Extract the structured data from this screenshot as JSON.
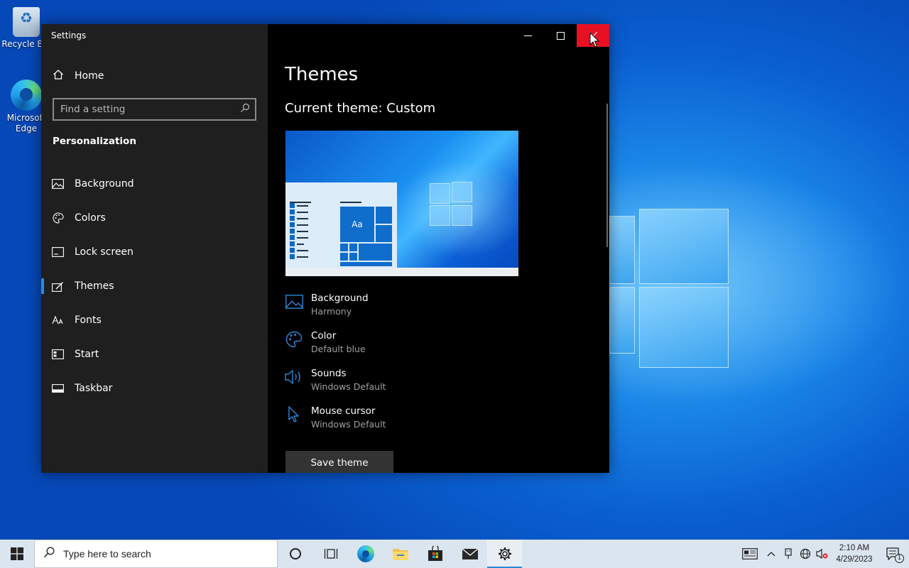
{
  "desktop": {
    "icons": [
      {
        "label": "Recycle Bin"
      },
      {
        "label": "Microsoft Edge"
      }
    ]
  },
  "window": {
    "title": "Settings",
    "nav": {
      "home_label": "Home",
      "search_placeholder": "Find a setting",
      "section_title": "Personalization",
      "items": [
        {
          "label": "Background",
          "icon": "picture-icon"
        },
        {
          "label": "Colors",
          "icon": "palette-icon"
        },
        {
          "label": "Lock screen",
          "icon": "lock-screen-icon"
        },
        {
          "label": "Themes",
          "icon": "themes-icon",
          "selected": true
        },
        {
          "label": "Fonts",
          "icon": "font-icon"
        },
        {
          "label": "Start",
          "icon": "start-icon"
        },
        {
          "label": "Taskbar",
          "icon": "taskbar-icon"
        }
      ]
    },
    "main": {
      "title": "Themes",
      "current_theme": "Current theme: Custom",
      "preview_tile_text": "Aa",
      "properties": [
        {
          "name": "Background",
          "value": "Harmony",
          "icon": "picture-icon"
        },
        {
          "name": "Color",
          "value": "Default blue",
          "icon": "palette-icon"
        },
        {
          "name": "Sounds",
          "value": "Windows Default",
          "icon": "speaker-icon"
        },
        {
          "name": "Mouse cursor",
          "value": "Windows Default",
          "icon": "cursor-icon"
        }
      ],
      "save_button": "Save theme"
    }
  },
  "taskbar": {
    "search_placeholder": "Type here to search",
    "apps": [
      "cortana-icon",
      "task-view-icon",
      "edge-icon",
      "file-explorer-icon",
      "store-icon",
      "mail-icon",
      "settings-icon"
    ],
    "clock": {
      "time": "2:10 AM",
      "date": "4/29/2023"
    },
    "notification_count": "1"
  },
  "colors": {
    "accent": "#2b88d8",
    "close": "#e81123",
    "nav_bg": "#1f1f1f"
  }
}
